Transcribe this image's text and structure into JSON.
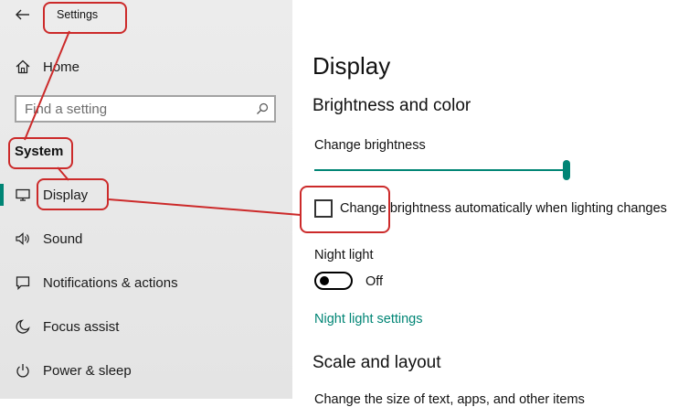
{
  "sidebar": {
    "header": {
      "back_icon": "back-arrow-icon",
      "title": "Settings"
    },
    "home": {
      "label": "Home",
      "icon": "home-icon"
    },
    "search": {
      "placeholder": "Find a setting",
      "value": ""
    },
    "section_heading": "System",
    "items": [
      {
        "label": "Display",
        "icon": "monitor-icon",
        "selected": true
      },
      {
        "label": "Sound",
        "icon": "speaker-icon"
      },
      {
        "label": "Notifications & actions",
        "icon": "notification-icon"
      },
      {
        "label": "Focus assist",
        "icon": "moon-icon"
      },
      {
        "label": "Power & sleep",
        "icon": "power-icon"
      }
    ]
  },
  "main": {
    "title": "Display",
    "brightness_section": {
      "heading": "Brightness and color",
      "slider_label": "Change brightness",
      "brightness_value_percent": 100,
      "auto_brightness_label": "Change brightness automatically when lighting changes",
      "auto_brightness_checked": false
    },
    "night_light": {
      "label": "Night light",
      "state": "Off",
      "settings_link": "Night light settings"
    },
    "scale_section": {
      "heading": "Scale and layout",
      "partial_text": "Change the size of text, apps, and other items"
    }
  },
  "colors": {
    "accent": "#008575",
    "annotation": "#cc2a2a",
    "sidebar_bg": "#e6e6e6"
  }
}
